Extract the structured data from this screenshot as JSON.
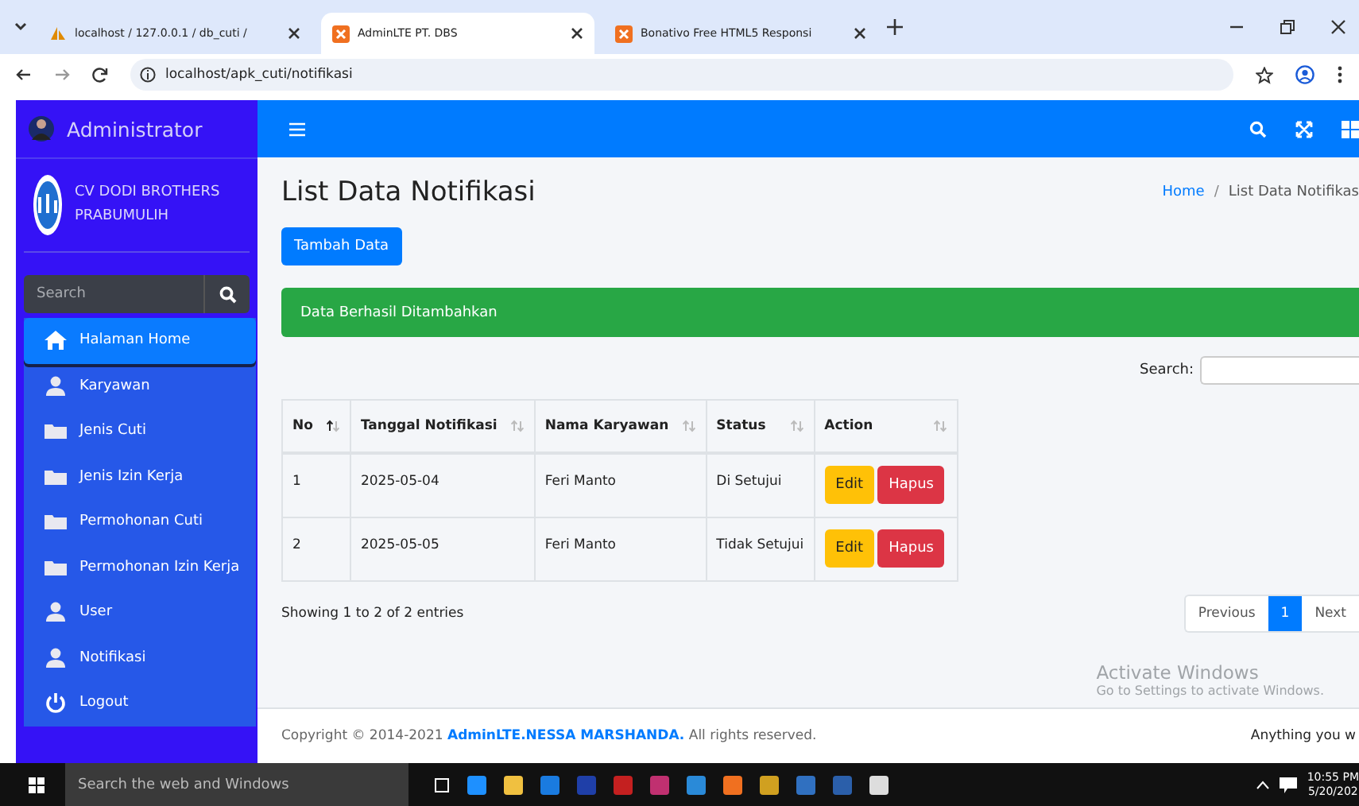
{
  "browser": {
    "tabs": [
      {
        "title": "localhost / 127.0.0.1 / db_cuti /",
        "kind": "sail",
        "selected": false
      },
      {
        "title": "AdminLTE PT. DBS",
        "kind": "xampp",
        "selected": true
      },
      {
        "title": "Bonativo Free HTML5 Responsi",
        "kind": "xampp",
        "selected": false
      }
    ],
    "url": "localhost/apk_cuti/notifikasi"
  },
  "sidebar": {
    "brand": "Administrator",
    "company": "CV DODI BROTHERS PRABUMULIH",
    "search": {
      "placeholder": "Search"
    },
    "items": [
      {
        "label": "Halaman Home",
        "kind": "home",
        "selected": true
      },
      {
        "label": "Karyawan",
        "kind": "user",
        "selected": false
      },
      {
        "label": "Jenis Cuti",
        "kind": "folder",
        "selected": false
      },
      {
        "label": "Jenis Izin Kerja",
        "kind": "folder",
        "selected": false
      },
      {
        "label": "Permohonan Cuti",
        "kind": "folder",
        "selected": false
      },
      {
        "label": "Permohonan Izin Kerja",
        "kind": "folder",
        "selected": false
      },
      {
        "label": "User",
        "kind": "user",
        "selected": false
      },
      {
        "label": "Notifikasi",
        "kind": "user",
        "selected": false
      },
      {
        "label": "Logout",
        "kind": "power",
        "selected": false
      }
    ]
  },
  "page": {
    "title": "List Data Notifikasi",
    "breadcrumb": {
      "items": [
        "Home",
        "List Data Notifikas"
      ],
      "separator": "/"
    },
    "add_button": "Tambah Data",
    "alert": "Data Berhasil Ditambahkan",
    "search_label": "Search:"
  },
  "table": {
    "columns": [
      {
        "label": "No",
        "sorted": true
      },
      {
        "label": "Tanggal Notifikasi",
        "sorted": false
      },
      {
        "label": "Nama Karyawan",
        "sorted": false
      },
      {
        "label": "Status",
        "sorted": false
      },
      {
        "label": "Action",
        "sorted": false
      }
    ],
    "rows": [
      {
        "cells": [
          "1",
          "2025-05-04",
          "Feri Manto",
          "Di Setujui"
        ],
        "actions": [
          "Edit",
          "Hapus"
        ]
      },
      {
        "cells": [
          "2",
          "2025-05-05",
          "Feri Manto",
          "Tidak Setujui"
        ],
        "actions": [
          "Edit",
          "Hapus"
        ]
      }
    ]
  },
  "info": "Showing 1 to 2 of 2 entries",
  "pagination": [
    {
      "label": "Previous",
      "selected": false
    },
    {
      "label": "1",
      "selected": true
    },
    {
      "label": "Next",
      "selected": false
    }
  ],
  "footer": {
    "text": "Copyright © 2014-2021 **AdminLTE.NESSA MARSHANDA.** All rights reserved.",
    "right": "Anything you w"
  },
  "activation": {
    "title": "Activate Windows",
    "hint": "Go to Settings to activate Windows."
  },
  "taskbar": {
    "search": "Search the web and Windows",
    "time": "10:55 PM",
    "date": "5/20/202"
  }
}
